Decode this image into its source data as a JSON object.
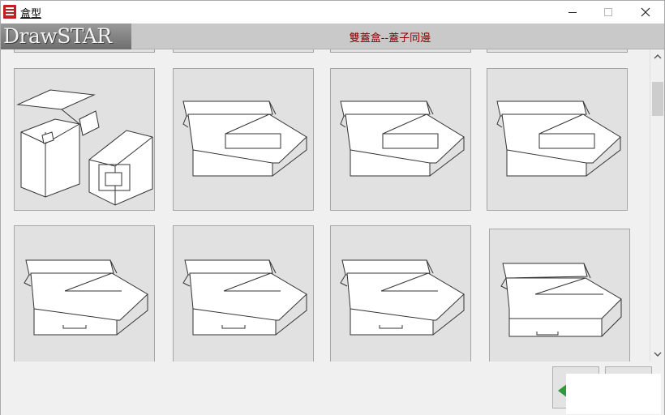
{
  "window": {
    "title": "盒型",
    "app_icon": "drawstar-app-icon",
    "minimize_icon": "minimize-icon",
    "maximize_icon": "maximize-icon",
    "close_icon": "close-icon"
  },
  "header": {
    "logo_text": "DrawSTAR",
    "box_type_title": "雙蓋盒--蓋子同邊"
  },
  "gallery": {
    "items": [
      {
        "icon": "box-with-insert-icon"
      },
      {
        "icon": "tray-lid-box-icon"
      },
      {
        "icon": "tray-lid-box-icon"
      },
      {
        "icon": "tray-lid-box-icon"
      },
      {
        "icon": "tray-lid-cutout-box-icon"
      },
      {
        "icon": "tray-lid-cutout-box-icon"
      },
      {
        "icon": "tray-lid-cutout-box-icon"
      },
      {
        "icon": "tray-lid-tab-box-icon"
      }
    ]
  },
  "scrollbar": {
    "up_icon": "chevron-up-icon",
    "down_icon": "chevron-down-icon"
  },
  "footer": {
    "back_icon": "arrow-left-icon",
    "help_icon": "help-icon"
  },
  "colors": {
    "title_text": "#8b0000",
    "header_band": "#c9c9c9",
    "thumb_bg": "#e1e1e1",
    "back_arrow": "#2f9a3a"
  }
}
